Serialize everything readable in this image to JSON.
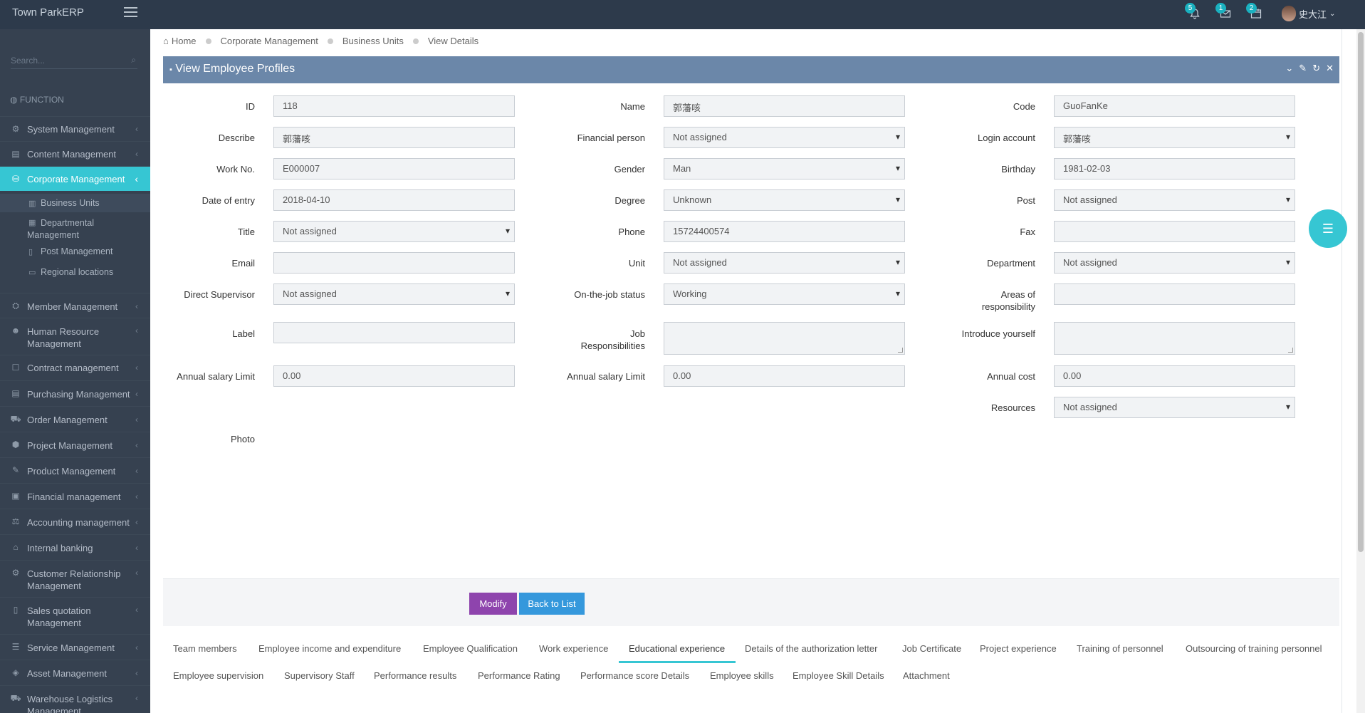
{
  "app": {
    "brand": "Town ParkERP"
  },
  "topbar": {
    "notifications_badge": "5",
    "messages_badge": "1",
    "tasks_badge": "2",
    "user_name": "史大江"
  },
  "sidebar": {
    "search_placeholder": "Search...",
    "section_label": "FUNCTION",
    "items": [
      {
        "label": "System Management"
      },
      {
        "label": "Content Management"
      },
      {
        "label": "Corporate Management"
      },
      {
        "label": "Member Management"
      },
      {
        "label": "Human Resource Management"
      },
      {
        "label": "Contract management"
      },
      {
        "label": "Purchasing Management"
      },
      {
        "label": "Order Management"
      },
      {
        "label": "Project Management"
      },
      {
        "label": "Product Management"
      },
      {
        "label": "Financial management"
      },
      {
        "label": "Accounting management"
      },
      {
        "label": "Internal banking"
      },
      {
        "label": "Customer Relationship Management"
      },
      {
        "label": "Sales quotation Management"
      },
      {
        "label": "Service Management"
      },
      {
        "label": "Asset Management"
      },
      {
        "label": "Warehouse Logistics Management"
      }
    ],
    "sub_items": [
      {
        "label": "Business Units"
      },
      {
        "label": "Departmental Management"
      },
      {
        "label": "Post Management"
      },
      {
        "label": "Regional locations"
      }
    ]
  },
  "breadcrumb": [
    "Home",
    "Corporate Management",
    "Business Units",
    "View Details"
  ],
  "portlet": {
    "title": "View Employee Profiles"
  },
  "form": {
    "id": {
      "label": "ID",
      "value": "118"
    },
    "name": {
      "label": "Name",
      "value": "郭藩咳"
    },
    "code": {
      "label": "Code",
      "value": "GuoFanKe"
    },
    "describe": {
      "label": "Describe",
      "value": "郭藩咳"
    },
    "financial_person": {
      "label": "Financial person",
      "value": "Not assigned"
    },
    "login_account": {
      "label": "Login account",
      "value": "郭藩咳"
    },
    "work_no": {
      "label": "Work No.",
      "value": "E000007"
    },
    "gender": {
      "label": "Gender",
      "value": "Man"
    },
    "birthday": {
      "label": "Birthday",
      "value": "1981-02-03"
    },
    "date_of_entry": {
      "label": "Date of entry",
      "value": "2018-04-10"
    },
    "degree": {
      "label": "Degree",
      "value": "Unknown"
    },
    "post": {
      "label": "Post",
      "value": "Not assigned"
    },
    "title": {
      "label": "Title",
      "value": "Not assigned"
    },
    "phone": {
      "label": "Phone",
      "value": "15724400574"
    },
    "fax": {
      "label": "Fax",
      "value": ""
    },
    "email": {
      "label": "Email",
      "value": ""
    },
    "unit": {
      "label": "Unit",
      "value": "Not assigned"
    },
    "department": {
      "label": "Department",
      "value": "Not assigned"
    },
    "direct_supervisor": {
      "label": "Direct Supervisor",
      "value": "Not assigned"
    },
    "on_job_status": {
      "label": "On-the-job status",
      "value": "Working"
    },
    "areas_of_responsibility": {
      "label": "Areas of responsibility",
      "value": ""
    },
    "label_field": {
      "label": "Label",
      "value": ""
    },
    "job_responsibilities": {
      "label": "Job Responsibilities",
      "value": ""
    },
    "introduce_yourself": {
      "label": "Introduce yourself",
      "value": ""
    },
    "annual_salary_limit_1": {
      "label": "Annual salary Limit",
      "value": "0.00"
    },
    "annual_salary_limit_2": {
      "label": "Annual salary Limit",
      "value": "0.00"
    },
    "annual_cost": {
      "label": "Annual cost",
      "value": "0.00"
    },
    "resources": {
      "label": "Resources",
      "value": "Not assigned"
    },
    "photo": {
      "label": "Photo"
    }
  },
  "actions": {
    "modify": "Modify",
    "back": "Back to List"
  },
  "tabs": {
    "row1": [
      "Team members",
      "Employee income and expenditure",
      "Employee Qualification",
      "Work experience",
      "Educational experience",
      "Details of the authorization letter",
      "Job Certificate",
      "Project experience",
      "Training of personnel",
      "Outsourcing of training personnel"
    ],
    "row2": [
      "Employee supervision",
      "Supervisory Staff",
      "Performance results",
      "Performance Rating",
      "Performance score Details",
      "Employee skills",
      "Employee Skill Details",
      "Attachment"
    ],
    "active": "Educational experience"
  },
  "colors": {
    "sidebar": "#364150",
    "topbar": "#2d3a4b",
    "accent": "#36c6d3",
    "portlet": "#6b87a9",
    "modify": "#8e44ad",
    "back": "#3598dc"
  }
}
